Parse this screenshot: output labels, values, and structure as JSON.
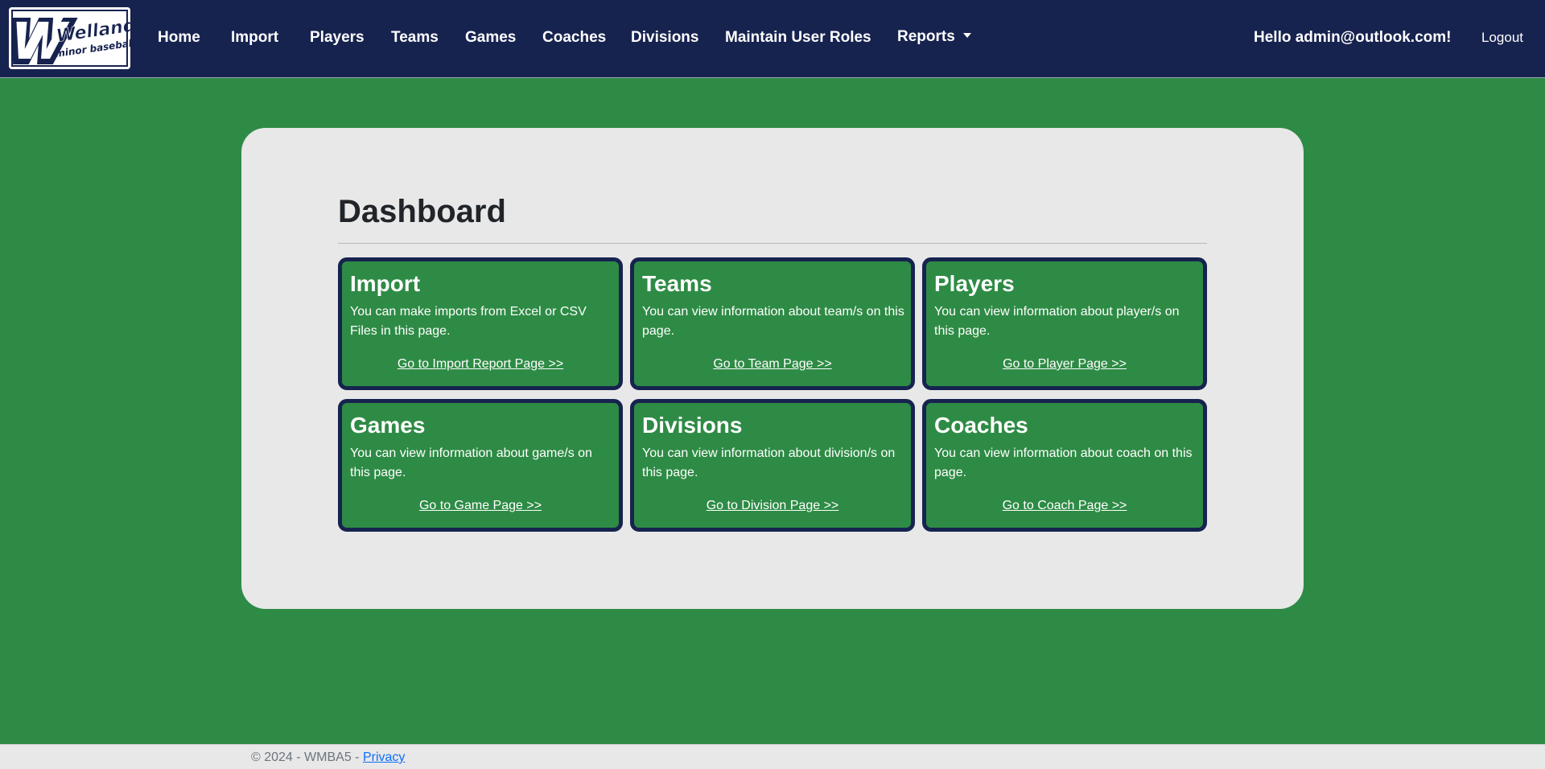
{
  "brand": {
    "logo_text_main": "Welland",
    "logo_text_sub": "minor baseball"
  },
  "nav": {
    "items": [
      {
        "label": "Home"
      },
      {
        "label": "Import"
      },
      {
        "label": "Players"
      },
      {
        "label": "Teams"
      },
      {
        "label": "Games"
      },
      {
        "label": "Coaches"
      },
      {
        "label": "Divisions"
      },
      {
        "label": "Maintain User Roles"
      },
      {
        "label": "Reports"
      }
    ],
    "greeting": "Hello admin@outlook.com!",
    "logout": "Logout"
  },
  "main": {
    "title": "Dashboard",
    "cards": [
      {
        "title": "Import",
        "text": "You can make imports from Excel or CSV Files in this page.",
        "link": "Go to Import Report Page >>"
      },
      {
        "title": "Teams",
        "text": "You can view information about team/s on this page.",
        "link": "Go to Team Page >>"
      },
      {
        "title": "Players",
        "text": "You can view information about player/s on this page.",
        "link": "Go to Player Page >>"
      },
      {
        "title": "Games",
        "text": "You can view information about game/s on this page.",
        "link": "Go to Game Page >>"
      },
      {
        "title": "Divisions",
        "text": "You can view information about division/s on this page.",
        "link": "Go to Division Page >>"
      },
      {
        "title": "Coaches",
        "text": "You can view information about coach on this page.",
        "link": "Go to Coach Page >>"
      }
    ]
  },
  "footer": {
    "copyright": "© 2024 - WMBA5 - ",
    "privacy": "Privacy"
  },
  "colors": {
    "navbar": "#17234f",
    "page_background": "#2e8b45",
    "panel": "#e8e8e8",
    "card": "#2e8b45",
    "card_border": "#17234f"
  }
}
